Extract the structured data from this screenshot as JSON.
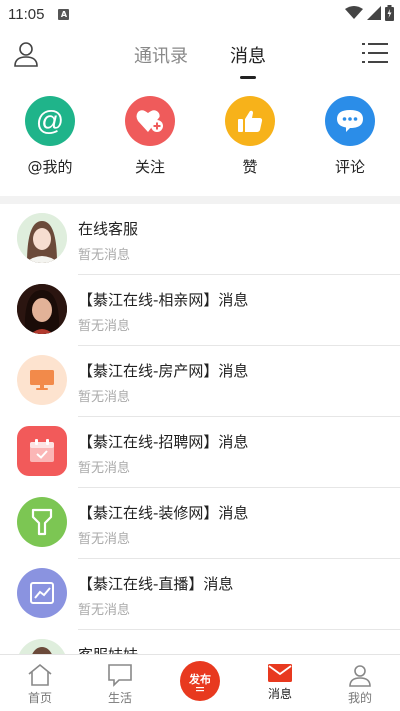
{
  "status_bar": {
    "time": "11:05",
    "notif_letter": "A"
  },
  "header": {
    "tabs": [
      {
        "label": "通讯录"
      },
      {
        "label": "消息"
      }
    ]
  },
  "quick_actions": [
    {
      "label": "@我的",
      "icon": "at-icon",
      "color": "#1fb48a"
    },
    {
      "label": "关注",
      "icon": "heart-plus-icon",
      "color": "#ef5b5b"
    },
    {
      "label": "赞",
      "icon": "thumbs-up-icon",
      "color": "#f7b21a"
    },
    {
      "label": "评论",
      "icon": "chat-bubble-icon",
      "color": "#2b8de8"
    }
  ],
  "messages": [
    {
      "title": "在线客服",
      "subtitle": "暂无消息",
      "icon": "support-avatar"
    },
    {
      "title": "【綦江在线-相亲网】消息",
      "subtitle": "暂无消息",
      "icon": "dating-avatar"
    },
    {
      "title": "【綦江在线-房产网】消息",
      "subtitle": "暂无消息",
      "icon": "monitor-icon",
      "color": "#fde3cf"
    },
    {
      "title": "【綦江在线-招聘网】消息",
      "subtitle": "暂无消息",
      "icon": "calendar-icon",
      "color": "#f25a5a"
    },
    {
      "title": "【綦江在线-装修网】消息",
      "subtitle": "暂无消息",
      "icon": "funnel-icon",
      "color": "#7cc653"
    },
    {
      "title": "【綦江在线-直播】消息",
      "subtitle": "暂无消息",
      "icon": "chart-icon",
      "color": "#8a93e0"
    },
    {
      "title": "客服妹妹",
      "subtitle": "",
      "icon": "support-avatar"
    }
  ],
  "bottom_nav": [
    {
      "label": "首页"
    },
    {
      "label": "生活"
    },
    {
      "label": "发布"
    },
    {
      "label": "消息"
    },
    {
      "label": "我的"
    }
  ]
}
